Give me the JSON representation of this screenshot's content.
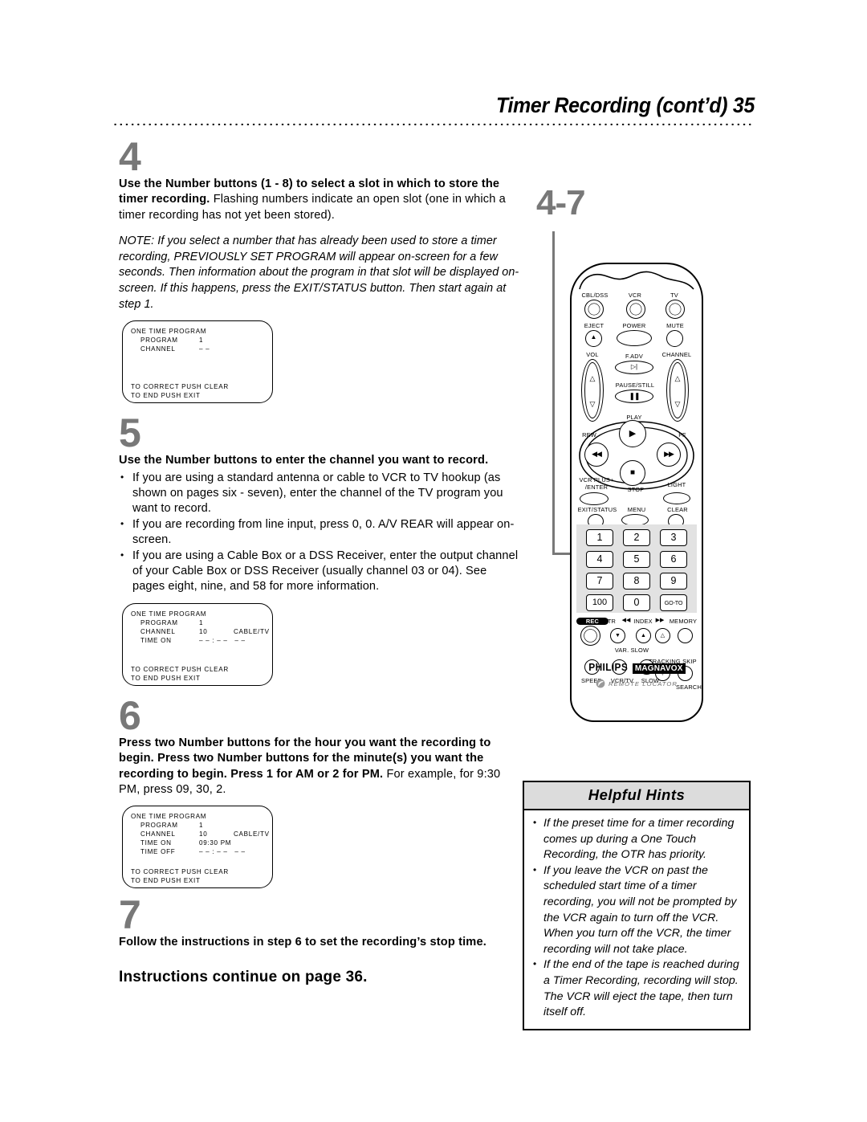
{
  "header": {
    "title": "Timer Recording (cont’d)  35"
  },
  "steps": [
    {
      "number": "4",
      "lead": "Use the Number buttons (1 - 8) to select a slot in which to store the timer recording.",
      "rest": " Flashing numbers indicate an open slot (one in which a timer recording has not yet been stored).",
      "note": "NOTE: If you select a number that has already been used to store a timer recording, PREVIOUSLY SET PROGRAM will appear on-screen for a few seconds. Then information about the program in that slot will be displayed on-screen. If this happens, press the EXIT/STATUS button. Then start again at step 1."
    },
    {
      "number": "5",
      "lead": "Use the Number buttons to enter the channel you want to record.",
      "bullets": [
        "If you are using a standard antenna or cable to VCR to TV hookup (as shown on pages six - seven), enter the channel of the TV program you want to record.",
        "If you are recording from line input, press 0, 0.  A/V REAR will appear on-screen.",
        "If you are using a Cable Box or a DSS Receiver, enter the output channel of your Cable Box or DSS Receiver (usually channel 03 or 04). See pages eight, nine, and 58 for more information."
      ]
    },
    {
      "number": "6",
      "lead": "Press two Number buttons for the hour you want the recording to begin. Press two Number buttons for the minute(s) you want the recording to begin. Press 1 for AM or 2 for PM.",
      "rest": "  For example, for 9:30 PM, press 09, 30, 2."
    },
    {
      "number": "7",
      "lead": "Follow the instructions in step 6 to set the recording’s stop time."
    }
  ],
  "continue_line": "Instructions continue on page 36.",
  "osd_screens": [
    {
      "title": "ONE TIME PROGRAM",
      "rows": [
        {
          "label": "PROGRAM",
          "v1": "1",
          "v2": ""
        },
        {
          "label": "CHANNEL",
          "v1": "– –",
          "v2": ""
        }
      ],
      "footer1": "TO CORRECT PUSH CLEAR",
      "footer2": "TO END PUSH EXIT"
    },
    {
      "title": "ONE TIME PROGRAM",
      "rows": [
        {
          "label": "PROGRAM",
          "v1": "1",
          "v2": ""
        },
        {
          "label": "CHANNEL",
          "v1": "10",
          "v2": "CABLE/TV"
        },
        {
          "label": "TIME ON",
          "v1": "– – : – –   – –",
          "v2": ""
        }
      ],
      "footer1": "TO CORRECT PUSH CLEAR",
      "footer2": "TO END PUSH EXIT"
    },
    {
      "title": "ONE TIME PROGRAM",
      "rows": [
        {
          "label": "PROGRAM",
          "v1": "1",
          "v2": ""
        },
        {
          "label": "CHANNEL",
          "v1": "10",
          "v2": "CABLE/TV"
        },
        {
          "label": "TIME ON",
          "v1": "09:30 PM",
          "v2": ""
        },
        {
          "label": "TIME OFF",
          "v1": "– – : – –   – –",
          "v2": ""
        }
      ],
      "footer1": "TO CORRECT PUSH CLEAR",
      "footer2": "TO END PUSH EXIT"
    }
  ],
  "callout": {
    "label": "4-7"
  },
  "remote": {
    "source_labels": [
      "CBL/DSS",
      "VCR",
      "TV"
    ],
    "power_row": [
      "EJECT",
      "POWER",
      "MUTE"
    ],
    "vol_label": "VOL",
    "channel_label": "CHANNEL",
    "fadv_label": "F.ADV",
    "pause_label": "PAUSE/STILL",
    "play_label": "PLAY",
    "rew_label": "REW",
    "ff_label": "FF",
    "stop_label": "STOP",
    "vcrplus_label1": "VCR PLUS+",
    "vcrplus_label2": "/ENTER",
    "light_label": "LIGHT",
    "exit_label": "EXIT/STATUS",
    "menu_label": "MENU",
    "clear_label": "CLEAR",
    "keypad": [
      "1",
      "2",
      "3",
      "4",
      "5",
      "6",
      "7",
      "8",
      "9",
      "100",
      "0",
      "GO-TO"
    ],
    "rec_label": "REC",
    "otr_label": "OTR",
    "index_label": "INDEX",
    "memory_label": "MEMORY",
    "varslow_label": "VAR. SLOW",
    "tracking_label": "TRACKING",
    "skip_label": "SKIP",
    "speed_label": "SPEED",
    "vcrtv_label": "VCR/TV",
    "slow_label": "SLOW",
    "search_label": "SEARCH",
    "brand1": "PHILIPS",
    "brand2": "MAGNAVOX",
    "locator": "REMOTE LOCATOR"
  },
  "hints": {
    "title": "Helpful Hints",
    "items": [
      "If the preset time for a timer recording comes up during a One Touch Recording, the OTR has priority.",
      "If you leave the VCR on past the scheduled start time of a timer recording, you will not be prompted by the VCR again to turn off the VCR. When you turn off the VCR, the timer recording will not take place.",
      "If the end of the tape is reached during a Timer Recording, recording will stop. The VCR will eject the tape, then turn itself off."
    ]
  },
  "colors": {
    "step_number": "#787878",
    "keypad_highlight": "#e2e2e2",
    "hints_header": "#dcdcdc"
  }
}
